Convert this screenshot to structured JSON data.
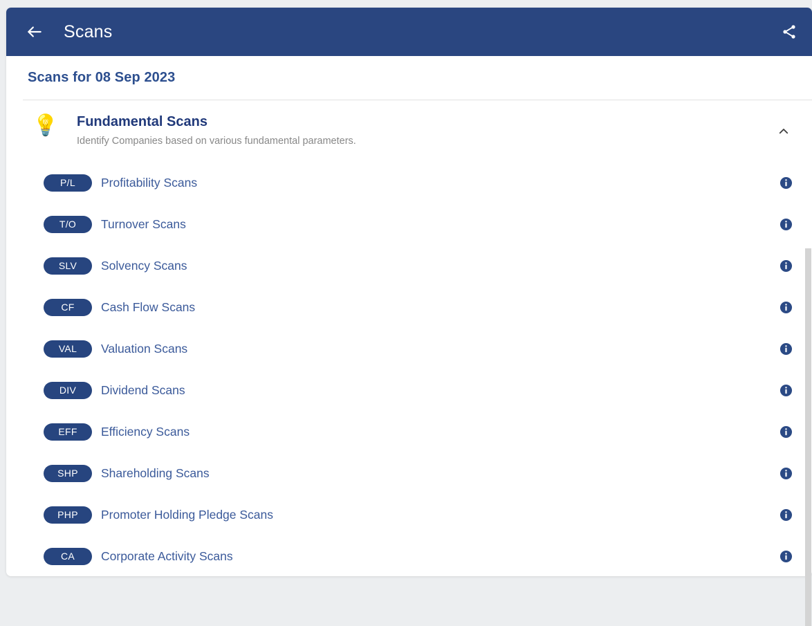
{
  "appbar": {
    "title": "Scans",
    "back_icon": "arrow-left-icon",
    "share_icon": "share-icon",
    "background_color": "#2a4680"
  },
  "date_header": {
    "text": "Scans for 08 Sep 2023",
    "color": "#2d4f8f"
  },
  "section": {
    "icon": "lightbulb-icon",
    "icon_glyph": "💡",
    "title": "Fundamental Scans",
    "subtitle": "Identify Companies based on various fundamental parameters.",
    "collapse_icon": "chevron-up-icon",
    "expanded": true
  },
  "colors": {
    "pill_background": "#27457f",
    "pill_text": "#ffffff",
    "row_label": "#3b5a9a",
    "info_icon": "#2b4a85",
    "page_background": "#eceef0",
    "card_background": "#ffffff",
    "divider": "#e2e2e2"
  },
  "scans": [
    {
      "code": "P/L",
      "label": "Profitability Scans",
      "info_icon": "info-icon"
    },
    {
      "code": "T/O",
      "label": "Turnover Scans",
      "info_icon": "info-icon"
    },
    {
      "code": "SLV",
      "label": "Solvency Scans",
      "info_icon": "info-icon"
    },
    {
      "code": "CF",
      "label": "Cash Flow Scans",
      "info_icon": "info-icon"
    },
    {
      "code": "VAL",
      "label": "Valuation Scans",
      "info_icon": "info-icon"
    },
    {
      "code": "DIV",
      "label": "Dividend Scans",
      "info_icon": "info-icon"
    },
    {
      "code": "EFF",
      "label": "Efficiency Scans",
      "info_icon": "info-icon"
    },
    {
      "code": "SHP",
      "label": "Shareholding Scans",
      "info_icon": "info-icon"
    },
    {
      "code": "PHP",
      "label": "Promoter Holding Pledge Scans",
      "info_icon": "info-icon"
    },
    {
      "code": "CA",
      "label": "Corporate Activity Scans",
      "info_icon": "info-icon"
    }
  ]
}
